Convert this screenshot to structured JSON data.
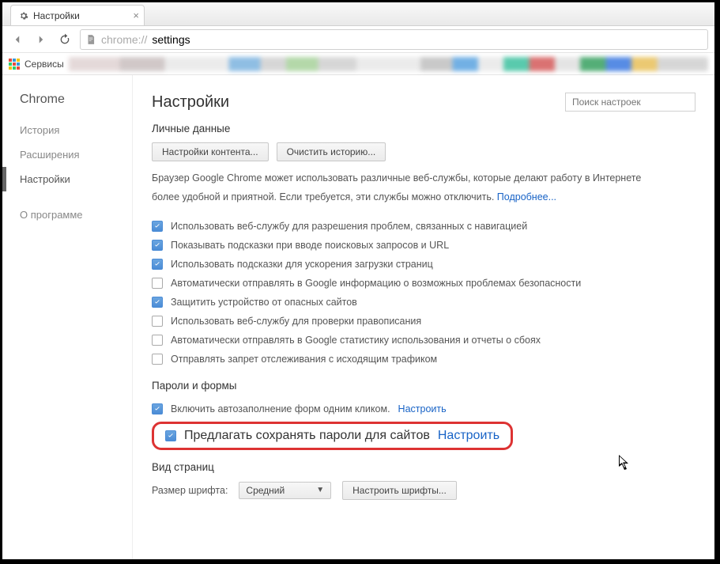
{
  "tab": {
    "title": "Настройки"
  },
  "omnibox": {
    "prefix": "chrome://",
    "path": "settings"
  },
  "bookmarks": {
    "apps_label": "Сервисы"
  },
  "sidebar": {
    "brand": "Chrome",
    "items": [
      "История",
      "Расширения",
      "Настройки"
    ],
    "about": "О программе"
  },
  "main": {
    "title": "Настройки",
    "search_placeholder": "Поиск настроек",
    "section_personal": "Личные данные",
    "btn_content": "Настройки контента...",
    "btn_clear": "Очистить историю...",
    "desc_a": "Браузер Google Chrome может использовать различные веб-службы, которые делают работу в Интернете более удобной и приятной. Если требуется, эти службы можно отключить. ",
    "desc_more": "Подробнее...",
    "privacy_opts": [
      {
        "label": "Использовать веб-службу для разрешения проблем, связанных с навигацией",
        "checked": true
      },
      {
        "label": "Показывать подсказки при вводе поисковых запросов и URL",
        "checked": true
      },
      {
        "label": "Использовать подсказки для ускорения загрузки страниц",
        "checked": true
      },
      {
        "label": "Автоматически отправлять в Google информацию о возможных проблемах безопасности",
        "checked": false
      },
      {
        "label": "Защитить устройство от опасных сайтов",
        "checked": true
      },
      {
        "label": "Использовать веб-службу для проверки правописания",
        "checked": false
      },
      {
        "label": "Автоматически отправлять в Google статистику использования и отчеты о сбоях",
        "checked": false
      },
      {
        "label": "Отправлять запрет отслеживания с исходящим трафиком",
        "checked": false
      }
    ],
    "section_passwords": "Пароли и формы",
    "pw_autofill_label": "Включить автозаполнение форм одним кликом.",
    "pw_autofill_link": "Настроить",
    "pw_save_label": "Предлагать сохранять пароли для сайтов",
    "pw_save_link": "Настроить",
    "section_view": "Вид страниц",
    "font_size_label": "Размер шрифта:",
    "font_size_value": "Средний",
    "font_customize": "Настроить шрифты..."
  }
}
